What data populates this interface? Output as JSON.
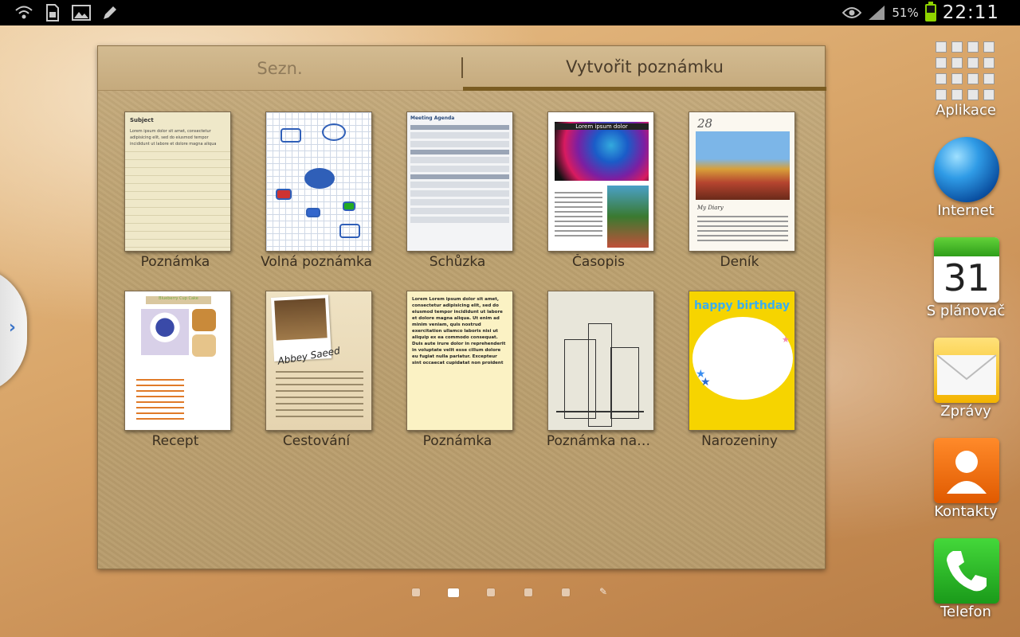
{
  "status_bar": {
    "icons": [
      "wifi-icon",
      "sim-icon",
      "gallery-icon",
      "pen-icon"
    ],
    "right_icons": [
      "eye-icon",
      "signal-icon"
    ],
    "battery_percent": "51%",
    "battery_level": 0.51,
    "battery_color": "#8fd400",
    "time": "22:11"
  },
  "side_handle": {
    "icon": "chevron-right-icon",
    "glyph": "›"
  },
  "memo_widget": {
    "tabs": [
      {
        "label": "Sezn.",
        "active": false
      },
      {
        "label": "Vytvořit poznámku",
        "active": true
      }
    ],
    "templates": [
      {
        "label": "Poznámka",
        "thumb_header": "Subject",
        "thumb_text": "Lorem ipsum dolor sit amet, consectetur adipisicing elit, sed do eiusmod tempor incididunt ut labore et dolore magna aliqua"
      },
      {
        "label": "Volná poznámka"
      },
      {
        "label": "Schůzka",
        "thumb_header": "Meeting Agenda"
      },
      {
        "label": "Časopis",
        "thumb_header": "Lorem ipsum dolor"
      },
      {
        "label": "Deník",
        "thumb_date": "28",
        "thumb_caption": "My Diary"
      },
      {
        "label": "Recept",
        "thumb_header": "Blueberry Cup Cake"
      },
      {
        "label": "Cestování",
        "thumb_caption": "Abbey Saeed"
      },
      {
        "label": "Poznámka",
        "thumb_text": "Lorem Lorem ipsum dolor sit amet, consectetur adipisicing elit, sed do eiusmod tempor incididunt ut labore et dolore magna aliqua. Ut enim ad minim veniam, quis nostrud exercitation ullamco laboris nisi ut aliquip ex ea commodo consequat. Duis aute irure dolor in reprehenderit in voluptate velit esse cillum dolore eu fugiat nulla pariatur. Excepteur sint occaecat cupidatat non proident"
      },
      {
        "label": "Poznámka na…"
      },
      {
        "label": "Narozeniny",
        "thumb_header": "happy birthday"
      }
    ]
  },
  "page_indicator": {
    "count": 5,
    "active_index": 1,
    "extra_icon": "pen-icon"
  },
  "dock": [
    {
      "label": "Aplikace",
      "icon": "apps-grid-icon"
    },
    {
      "label": "Internet",
      "icon": "globe-icon"
    },
    {
      "label": "S plánovač",
      "icon": "calendar-icon",
      "day": "31"
    },
    {
      "label": "Zprávy",
      "icon": "envelope-icon"
    },
    {
      "label": "Kontakty",
      "icon": "contact-icon"
    },
    {
      "label": "Telefon",
      "icon": "phone-icon"
    }
  ]
}
